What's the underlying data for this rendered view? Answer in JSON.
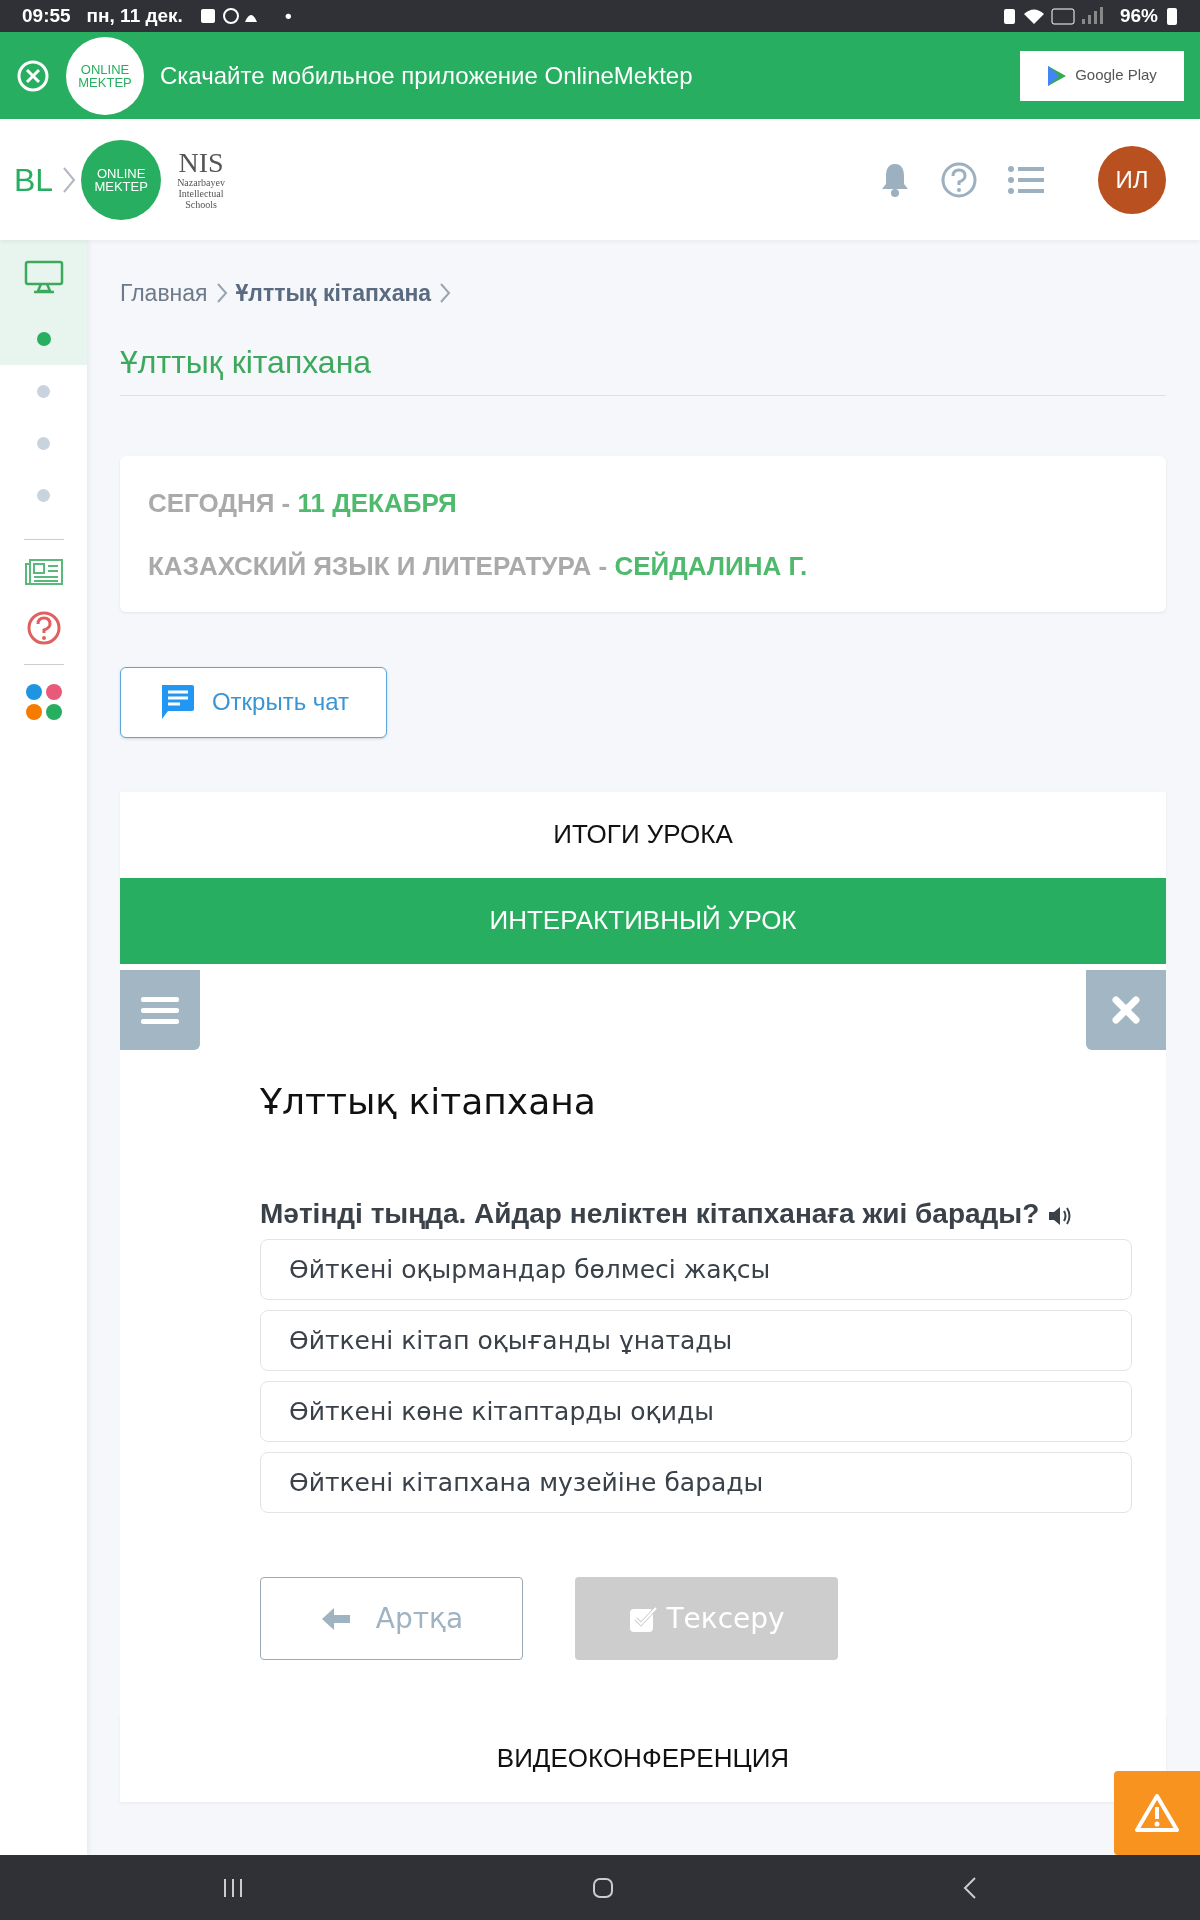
{
  "status_bar": {
    "time": "09:55",
    "date": "пн, 11 дек.",
    "dot": "•",
    "battery": "96%"
  },
  "banner": {
    "logo": [
      "ONLINE",
      "MEKTEP"
    ],
    "text": "Скачайте мобильное приложение OnlineMektep",
    "store_button": "Google Play"
  },
  "header": {
    "brand": "BL",
    "logo": [
      "ONLINE",
      "MEKTEP"
    ],
    "nis": {
      "mark": "NIS",
      "lines": [
        "Nazarbayev",
        "Intellectual",
        "Schools"
      ]
    },
    "avatar": "ИЛ"
  },
  "sidebar": {
    "steps": [
      {
        "selected": true
      },
      {
        "selected": false
      },
      {
        "selected": false
      },
      {
        "selected": false
      }
    ]
  },
  "breadcrumb": [
    {
      "label": "Главная",
      "current": false
    },
    {
      "label": "Ұлттық кітапхана",
      "current": true
    }
  ],
  "page_title": "Ұлттық кітапхана",
  "info": {
    "date_label": "СЕГОДНЯ -",
    "date": "11 ДЕКАБРЯ",
    "subject": "КАЗАХСКИЙ ЯЗЫК И ЛИТЕРАТУРА -",
    "teacher": "СЕЙДАЛИНА Г."
  },
  "chat_button": "Открыть чат",
  "sections": [
    {
      "title": "ИТОГИ УРОКА",
      "expanded": false
    },
    {
      "title": "ИНТЕРАКТИВНЫЙ УРОК",
      "expanded": true,
      "lesson": {
        "title": "Ұлттық кітапхана",
        "question": "Мәтінді тыңда. Айдар неліктен кітапханаға жиі барады?",
        "options": [
          {
            "text": "Өйткені оқырмандар бөлмесі жақсы",
            "selected": false
          },
          {
            "text": "Өйткені кітап оқығанды ұнатады",
            "selected": false
          },
          {
            "text": "Өйткені көне кітаптарды оқиды",
            "selected": false
          },
          {
            "text": "Өйткені кітапхана музейіне барады",
            "selected": false
          }
        ],
        "back_button": "Артқа",
        "check_button": {
          "label": "Тексеру",
          "disabled": true
        }
      }
    },
    {
      "title": "ВИДЕОКОНФЕРЕНЦИЯ",
      "expanded": false
    }
  ]
}
